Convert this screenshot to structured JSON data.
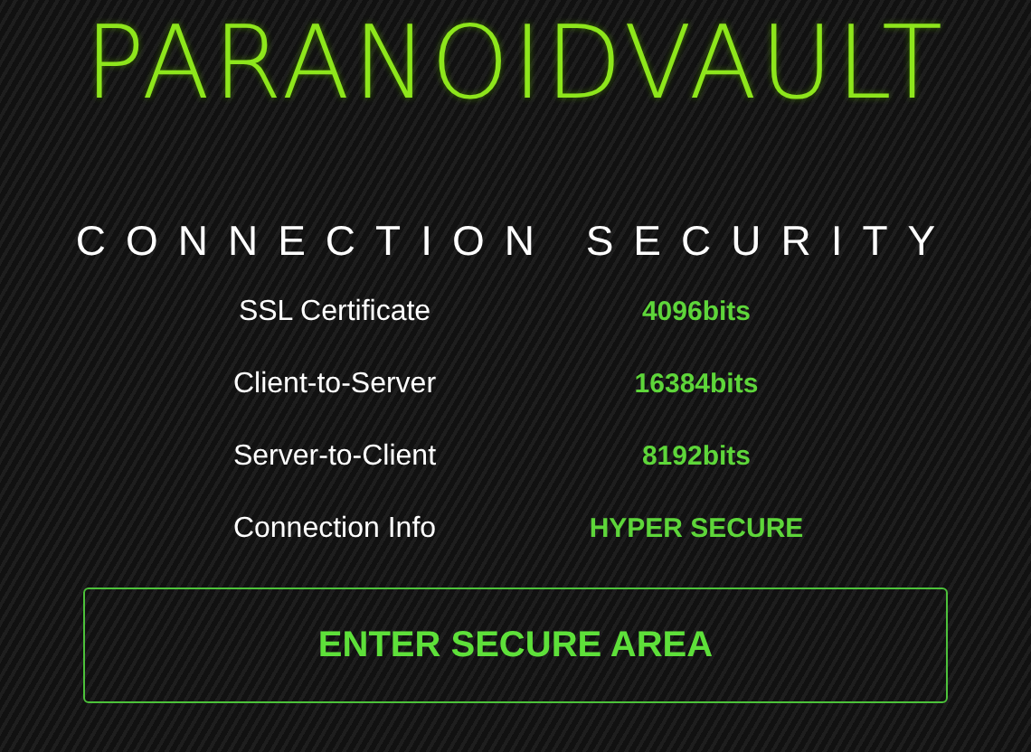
{
  "logo": "PARANOIDVAULT",
  "heading": "CONNECTION SECURITY",
  "rows": [
    {
      "label": "SSL Certificate",
      "value": "4096bits"
    },
    {
      "label": "Client-to-Server",
      "value": "16384bits"
    },
    {
      "label": "Server-to-Client",
      "value": "8192bits"
    },
    {
      "label": "Connection Info",
      "value": "HYPER SECURE"
    }
  ],
  "button": "ENTER SECURE AREA"
}
